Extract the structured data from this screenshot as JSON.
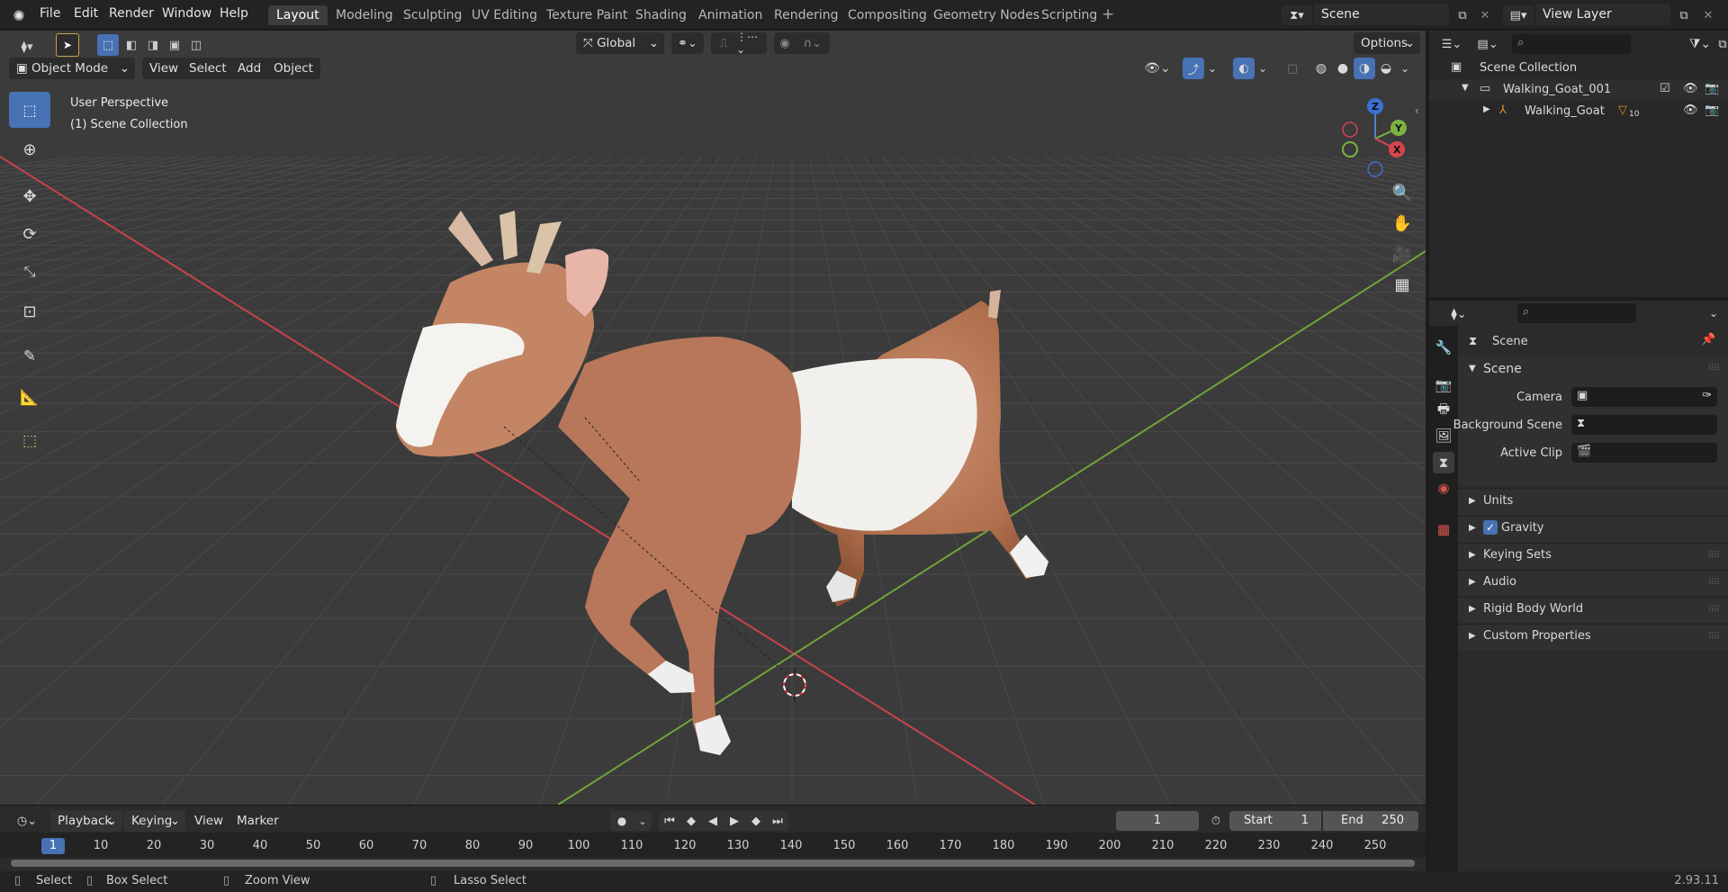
{
  "topbar": {
    "menus": [
      "File",
      "Edit",
      "Render",
      "Window",
      "Help"
    ],
    "workspace_tabs": [
      "Layout",
      "Modeling",
      "Sculpting",
      "UV Editing",
      "Texture Paint",
      "Shading",
      "Animation",
      "Rendering",
      "Compositing",
      "Geometry Nodes",
      "Scripting"
    ],
    "active_tab": "Layout",
    "add_tab": "+",
    "scene_field": "Scene",
    "view_layer_field": "View Layer"
  },
  "viewport": {
    "mode": "Object Mode",
    "menus": [
      "View",
      "Select",
      "Add",
      "Object"
    ],
    "transform_orientation": "Global",
    "options_label": "Options",
    "overlay_line1": "User Perspective",
    "overlay_line2": "(1) Scene Collection",
    "gizmo_labels": {
      "z": "Z",
      "y": "Y",
      "x": "X"
    },
    "colors": {
      "bg": "#3b3b3b",
      "grid": "#4a4a4a",
      "x_axis": "#c8434d",
      "y_axis": "#72a33a",
      "active_tool": "#4772b3"
    }
  },
  "outliner": {
    "root": "Scene Collection",
    "collection": "Walking_Goat_001",
    "object": "Walking_Goat",
    "object_badge": "10"
  },
  "properties": {
    "header": "Scene",
    "panel_scene": "Scene",
    "fields": [
      {
        "label": "Camera"
      },
      {
        "label": "Background Scene"
      },
      {
        "label": "Active Clip"
      }
    ],
    "sections": [
      "Units",
      "Gravity",
      "Keying Sets",
      "Audio",
      "Rigid Body World",
      "Custom Properties"
    ]
  },
  "timeline": {
    "menus": [
      "Playback",
      "Keying",
      "View",
      "Marker"
    ],
    "current_frame": "1",
    "start_label": "Start",
    "start_value": "1",
    "end_label": "End",
    "end_value": "250",
    "ruler_current": "1",
    "ruler_ticks": [
      "10",
      "20",
      "30",
      "40",
      "50",
      "60",
      "70",
      "80",
      "90",
      "100",
      "110",
      "120",
      "130",
      "140",
      "150",
      "160",
      "170",
      "180",
      "190",
      "200",
      "210",
      "220",
      "230",
      "240",
      "250"
    ]
  },
  "statusbar": {
    "select": "Select",
    "box_select": "Box Select",
    "zoom_view": "Zoom View",
    "lasso_select": "Lasso Select",
    "version": "2.93.11"
  }
}
